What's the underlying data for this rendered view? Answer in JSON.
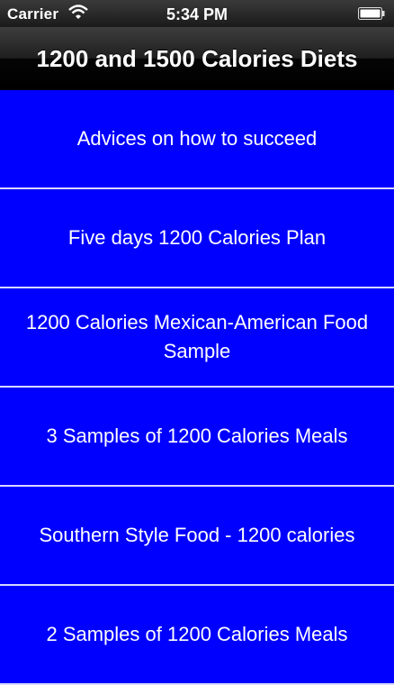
{
  "status_bar": {
    "carrier": "Carrier",
    "time": "5:34 PM",
    "wifi_icon": "wifi-icon",
    "battery_icon": "battery-icon"
  },
  "nav_bar": {
    "title": "1200 and 1500 Calories Diets"
  },
  "list": {
    "items": [
      {
        "label": "Advices on how to succeed"
      },
      {
        "label": "Five days 1200 Calories Plan"
      },
      {
        "label": "1200 Calories Mexican-American Food Sample"
      },
      {
        "label": "3 Samples of 1200 Calories Meals"
      },
      {
        "label": "Southern Style Food - 1200 calories"
      },
      {
        "label": "2 Samples of 1200 Calories Meals"
      }
    ]
  },
  "colors": {
    "list_background": "#0000ff",
    "separator": "#d8d8ff",
    "text": "#ffffff"
  }
}
